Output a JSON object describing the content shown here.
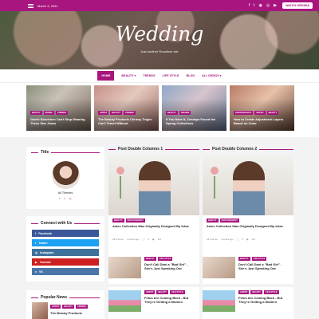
{
  "topbar": {
    "date": "March 3, 2021",
    "socials": [
      "f",
      "t",
      "◉",
      "◎",
      "▶"
    ],
    "watch_label": "WATCH VIRGINIA"
  },
  "hero": {
    "logo": "Wedding",
    "tagline": "Just another Rosafiore site"
  },
  "nav": {
    "items": [
      "HOME",
      "BEAUTY ▾",
      "TRENDS",
      "LIFE STYLE",
      "BLOG",
      "ALL DEMOS ▾"
    ]
  },
  "featured": [
    {
      "cats": [
        "BEAUTY",
        "MODEL",
        "TRENDS"
      ],
      "title": "Gisele Bündchen Can't Stop Wearing These Size Jeans"
    },
    {
      "cats": [
        "ARTIST",
        "BEAUTY",
        "TRENDS"
      ],
      "title": "The Beauty Products Chrissy Teigen Can't Travel Without"
    },
    {
      "cats": [
        "BEAUTY",
        "TRENDS"
      ],
      "title": "If You Have It, Zendaya Found the Spring Collections"
    },
    {
      "cats": [
        "PHOTOGRAPHY",
        "ARTIST",
        "BEAUTY"
      ],
      "title": "How to Create Adjustment Layers Based on Color"
    }
  ],
  "sidebar": {
    "title_widget": {
      "heading": "Title",
      "name": "All Themes",
      "socials": [
        "f",
        "t",
        "◎"
      ]
    },
    "connect": {
      "heading": "Connect with Us",
      "buttons": [
        "Facebook",
        "Twitter",
        "Instagram",
        "Youtube",
        "VK"
      ]
    },
    "popular": {
      "heading": "Popular News",
      "cats": [
        "ARTIST",
        "BEAUTY",
        "TRENDS"
      ],
      "title": "The Beauty Products"
    }
  },
  "columns": [
    {
      "heading": "Post Double Columns 1",
      "main": {
        "cats": [
          "BEAUTY",
          "PHOTOGRAPHY"
        ],
        "title": "Aztec Collection Was Originally Designed By Iskra",
        "author": "All Themes",
        "time": "4 weeks ago",
        "comments": "0",
        "views": "121"
      },
      "smalls": [
        {
          "cats": [
            "BEAUTY",
            "LIFE STYLE"
          ],
          "title": "Don't Call Dani a \"Bad Girl\" - She's Just Speaking Out"
        },
        {
          "cats": [
            "ARTIST",
            "BEAUTY",
            "LIFE STYLE"
          ],
          "title": "Fetus Are Coming Back - But They're Getting a Modern"
        }
      ]
    },
    {
      "heading": "Post Double Columns 2",
      "main": {
        "cats": [
          "BEAUTY",
          "PHOTOGRAPHY"
        ],
        "title": "Aztec Collection Was Originally Designed By Iskra",
        "author": "All Themes",
        "time": "4 weeks ago",
        "comments": "0",
        "views": "121"
      },
      "smalls": [
        {
          "cats": [
            "BEAUTY",
            "LIFE STYLE"
          ],
          "title": "Don't Call Dani a \"Bad Girl\" - She's Just Speaking Out"
        },
        {
          "cats": [
            "ARTIST",
            "BEAUTY",
            "LIFE STYLE"
          ],
          "title": "Fetus Are Coming Back - But They're Getting a Modern"
        }
      ]
    }
  ],
  "colors": {
    "accent": "#a8157e",
    "facebook": "#3b5998",
    "twitter": "#1da1f2",
    "instagram": "#3f729b",
    "youtube": "#cd201f",
    "vk": "#4a76a8"
  }
}
